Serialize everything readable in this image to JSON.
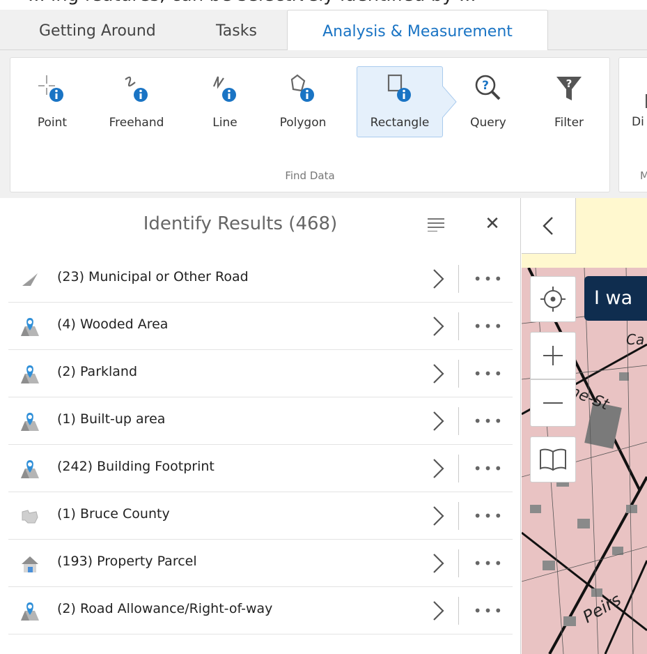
{
  "top_text": "... ing features, can be selectively identified by ...",
  "tabs": [
    {
      "label": "Getting Around"
    },
    {
      "label": "Tasks"
    },
    {
      "label": "Analysis & Measurement"
    }
  ],
  "ribbon": {
    "find_data": {
      "label": "Find Data",
      "tools": [
        {
          "label": "Point",
          "icon": "point-identify-icon"
        },
        {
          "label": "Freehand",
          "icon": "freehand-identify-icon"
        },
        {
          "label": "Line",
          "icon": "line-identify-icon"
        },
        {
          "label": "Polygon",
          "icon": "polygon-identify-icon"
        },
        {
          "label": "Rectangle",
          "icon": "rectangle-identify-icon",
          "selected": true
        },
        {
          "label": "Query",
          "icon": "query-icon"
        },
        {
          "label": "Filter",
          "icon": "filter-icon"
        }
      ]
    },
    "next_group": {
      "tool_fragment": "Di",
      "label_fragment": "M"
    }
  },
  "results": {
    "title": "Identify Results (468)",
    "items": [
      {
        "label": "(23) Municipal or Other Road",
        "icon": "road-icon"
      },
      {
        "label": "(4) Wooded Area",
        "icon": "map-pin-icon"
      },
      {
        "label": "(2) Parkland",
        "icon": "map-pin-icon"
      },
      {
        "label": "(1) Built-up area",
        "icon": "map-pin-icon"
      },
      {
        "label": "(242) Building Footprint",
        "icon": "map-pin-icon"
      },
      {
        "label": "(1) Bruce County",
        "icon": "county-icon"
      },
      {
        "label": "(193) Property Parcel",
        "icon": "house-icon"
      },
      {
        "label": "(2) Road Allowance/Right-of-way",
        "icon": "map-pin-icon"
      }
    ],
    "more_label": "•••"
  },
  "map": {
    "tooltip": "I wa",
    "labels": [
      "Ca",
      "ine-St",
      "Peirs"
    ]
  },
  "colors": {
    "accent": "#1a74c4",
    "selected_bg": "#e5f0fb",
    "tooltip_bg": "#0f2d4f",
    "map_parcel": "#e9c3c3"
  }
}
